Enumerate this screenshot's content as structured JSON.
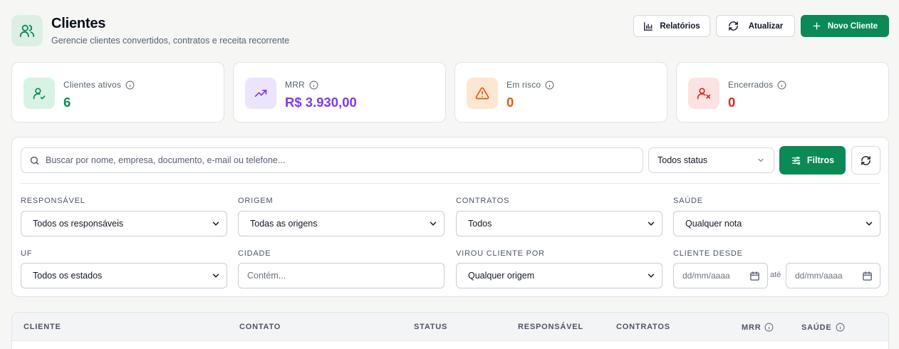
{
  "header": {
    "title": "Clientes",
    "subtitle": "Gerencie clientes convertidos, contratos e receita recorrente",
    "buttons": {
      "reports": "Relatórios",
      "refresh": "Atualizar",
      "new_client": "Novo Cliente"
    }
  },
  "stats": [
    {
      "label": "Clientes ativos",
      "value": "6",
      "color": "#0b8a55",
      "icon": "user-check-icon"
    },
    {
      "label": "MRR",
      "value": "R$ 3.930,00",
      "color": "#7c3aed",
      "icon": "trending-up-icon"
    },
    {
      "label": "Em risco",
      "value": "0",
      "color": "#ea580c",
      "icon": "warning-icon"
    },
    {
      "label": "Encerrados",
      "value": "0",
      "color": "#dc2626",
      "icon": "user-x-icon"
    }
  ],
  "filters": {
    "search_placeholder": "Buscar por nome, empresa, documento, e-mail ou telefone...",
    "status_value": "Todos status",
    "filters_button": "Filtros",
    "responsavel": {
      "label": "RESPONSÁVEL",
      "value": "Todos os responsáveis"
    },
    "origem": {
      "label": "ORIGEM",
      "value": "Todas as origens"
    },
    "contratos": {
      "label": "CONTRATOS",
      "value": "Todos"
    },
    "saude": {
      "label": "SAÚDE",
      "value": "Qualquer nota"
    },
    "uf": {
      "label": "UF",
      "value": "Todos os estados"
    },
    "cidade": {
      "label": "CIDADE",
      "placeholder": "Contém..."
    },
    "virou_cliente": {
      "label": "VIROU CLIENTE POR",
      "value": "Qualquer origem"
    },
    "cliente_desde": {
      "label": "CLIENTE DESDE",
      "from_placeholder": "dd/mm/aaaa",
      "separator": "até",
      "to_placeholder": "dd/mm/aaaa"
    }
  },
  "table": {
    "columns": [
      "CLIENTE",
      "CONTATO",
      "STATUS",
      "RESPONSÁVEL",
      "CONTRATOS",
      "MRR",
      "SAÚDE"
    ]
  },
  "colors": {
    "accent": "#0b8a55"
  }
}
